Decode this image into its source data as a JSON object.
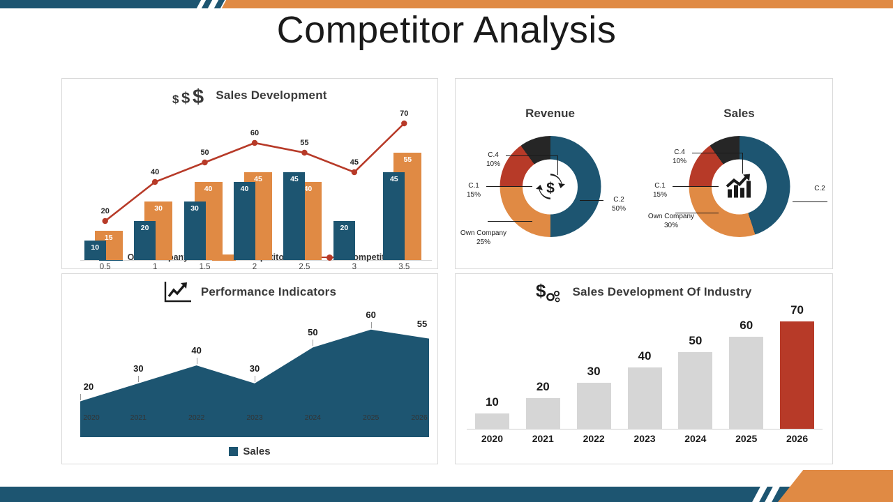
{
  "slide": {
    "title": "Competitor Analysis",
    "colors": {
      "teal": "#1d5571",
      "orange": "#e08a44",
      "red": "#b73a28",
      "dark": "#262626",
      "grey": "#d6d6d6"
    }
  },
  "panels": {
    "sales_development": {
      "title": "Sales Development",
      "icon": "triple-dollar-icon",
      "legend": [
        {
          "label": "Own Company",
          "color": "#1d5571",
          "marker": "swatch"
        },
        {
          "label": "Competitor 3",
          "color": "#e08a44",
          "marker": "swatch"
        },
        {
          "label": "Competitor 4",
          "color": "#b73a28",
          "marker": "line"
        }
      ]
    },
    "revenue_sales": {
      "revenue_title": "Revenue",
      "sales_title": "Sales",
      "revenue_icon": "dollar-refresh-icon",
      "sales_icon": "growth-arrow-icon"
    },
    "performance_indicators": {
      "title": "Performance Indicators",
      "icon": "line-chart-arrow-icon",
      "legend": [
        {
          "label": "Sales",
          "color": "#1d5571"
        }
      ]
    },
    "sales_development_industry": {
      "title": "Sales Development Of Industry",
      "icon": "dollar-gears-icon"
    }
  },
  "chart_data": [
    {
      "type": "bar",
      "id": "sales-development",
      "title": "Sales Development",
      "categories": [
        "0.5",
        "1",
        "1.5",
        "2",
        "2.5",
        "3",
        "3.5"
      ],
      "ylim": [
        0,
        75
      ],
      "grid": false,
      "legend_position": "bottom",
      "series": [
        {
          "name": "Own Company",
          "type": "bar",
          "color": "#1d5571",
          "values": [
            10,
            20,
            30,
            40,
            45,
            20,
            45
          ]
        },
        {
          "name": "Competitor 3",
          "type": "bar",
          "color": "#e08a44",
          "values": [
            15,
            30,
            40,
            45,
            40,
            null,
            55
          ]
        },
        {
          "name": "Competitor 4",
          "type": "line",
          "color": "#b73a28",
          "values": [
            20,
            40,
            50,
            60,
            55,
            45,
            70
          ]
        }
      ],
      "xlabel": "",
      "ylabel": ""
    },
    {
      "type": "pie",
      "id": "revenue-donut",
      "title": "Revenue",
      "donut": true,
      "slices": [
        {
          "label": "C.2",
          "value": 50,
          "display": "50%",
          "color": "#1d5571"
        },
        {
          "label": "Own Company",
          "value": 25,
          "display": "25%",
          "color": "#e08a44"
        },
        {
          "label": "C.1",
          "value": 15,
          "display": "15%",
          "color": "#b73a28"
        },
        {
          "label": "C.4",
          "value": 10,
          "display": "10%",
          "color": "#262626"
        }
      ]
    },
    {
      "type": "pie",
      "id": "sales-donut",
      "title": "Sales",
      "donut": true,
      "slices": [
        {
          "label": "C.2",
          "value": 45,
          "display": "",
          "color": "#1d5571"
        },
        {
          "label": "Own Company",
          "value": 30,
          "display": "30%",
          "color": "#e08a44"
        },
        {
          "label": "C.1",
          "value": 15,
          "display": "15%",
          "color": "#b73a28"
        },
        {
          "label": "C.4",
          "value": 10,
          "display": "10%",
          "color": "#262626"
        }
      ]
    },
    {
      "type": "area",
      "id": "performance-indicators",
      "title": "Performance Indicators",
      "categories": [
        "2020",
        "2021",
        "2022",
        "2023",
        "2024",
        "2025",
        "2026"
      ],
      "series": [
        {
          "name": "Sales",
          "color": "#1d5571",
          "values": [
            20,
            30,
            40,
            30,
            50,
            60,
            55
          ]
        }
      ],
      "ylim": [
        0,
        70
      ],
      "grid": false,
      "legend_position": "bottom",
      "xlabel": "",
      "ylabel": ""
    },
    {
      "type": "bar",
      "id": "sales-development-industry",
      "title": "Sales Development Of Industry",
      "categories": [
        "2020",
        "2021",
        "2022",
        "2023",
        "2024",
        "2025",
        "2026"
      ],
      "values": [
        10,
        20,
        30,
        40,
        50,
        60,
        70
      ],
      "bar_colors": [
        "#d6d6d6",
        "#d6d6d6",
        "#d6d6d6",
        "#d6d6d6",
        "#d6d6d6",
        "#d6d6d6",
        "#b73a28"
      ],
      "ylim": [
        0,
        78
      ],
      "grid": false,
      "xlabel": "",
      "ylabel": ""
    }
  ]
}
